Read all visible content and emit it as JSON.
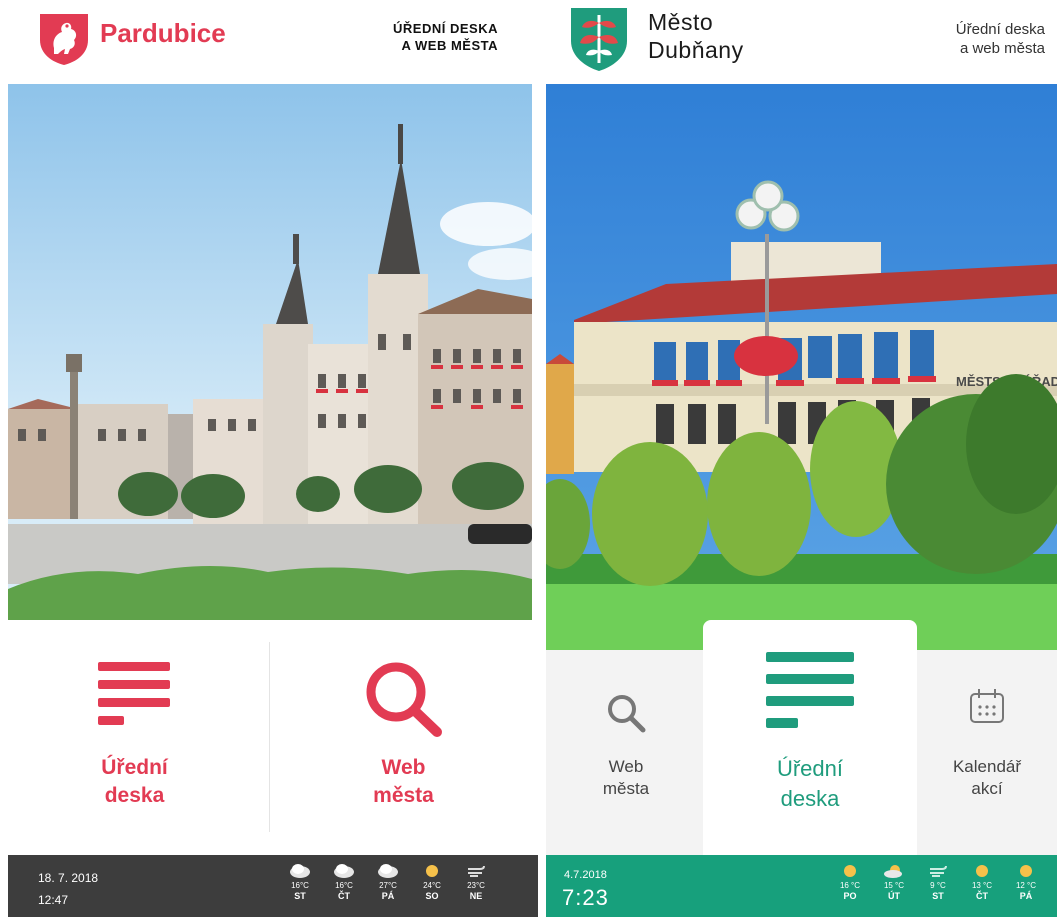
{
  "left": {
    "city_name": "Pardubice",
    "header_subtitle_line1": "ÚŘEDNÍ DESKA",
    "header_subtitle_line2": "A WEB MĚSTA",
    "tiles": [
      {
        "label_line1": "Úřední",
        "label_line2": "deska",
        "icon": "document-list-icon"
      },
      {
        "label_line1": "Web",
        "label_line2": "města",
        "icon": "search-icon"
      }
    ],
    "footer": {
      "date": "18. 7. 2018",
      "time": "12:47",
      "forecast": [
        {
          "temp": "16°C",
          "day": "ST",
          "icon": "cloud-icon"
        },
        {
          "temp": "16°C",
          "day": "ČT",
          "icon": "cloud-icon"
        },
        {
          "temp": "27°C",
          "day": "PÁ",
          "icon": "cloud-icon"
        },
        {
          "temp": "24°C",
          "day": "SO",
          "icon": "sun-icon"
        },
        {
          "temp": "23°C",
          "day": "NE",
          "icon": "wind-icon"
        }
      ]
    },
    "colors": {
      "accent": "#e23b53",
      "footer": "#3d3d3d"
    }
  },
  "right": {
    "city_line1": "Město",
    "city_line2": "Dubňany",
    "header_subtitle_line1": "Úřední deska",
    "header_subtitle_line2": "a web města",
    "photo_sign": "MĚSTSKÝ ÚŘAD",
    "tiles": [
      {
        "label_line1": "Web",
        "label_line2": "města",
        "icon": "search-icon"
      },
      {
        "label_line1": "Úřední",
        "label_line2": "deska",
        "icon": "document-list-icon"
      },
      {
        "label_line1": "Kalendář",
        "label_line2": "akcí",
        "icon": "calendar-icon"
      }
    ],
    "footer": {
      "date": "4.7.2018",
      "time": "7:23",
      "forecast": [
        {
          "temp": "16 °C",
          "day": "PO",
          "icon": "sun-icon"
        },
        {
          "temp": "15 °C",
          "day": "ÚT",
          "icon": "partly-cloudy-icon"
        },
        {
          "temp": "9 °C",
          "day": "ST",
          "icon": "wind-icon"
        },
        {
          "temp": "13 °C",
          "day": "ČT",
          "icon": "sun-icon"
        },
        {
          "temp": "12 °C",
          "day": "PÁ",
          "icon": "sun-icon"
        }
      ]
    },
    "colors": {
      "accent": "#1f9c7d",
      "footer": "#17a07c"
    }
  }
}
